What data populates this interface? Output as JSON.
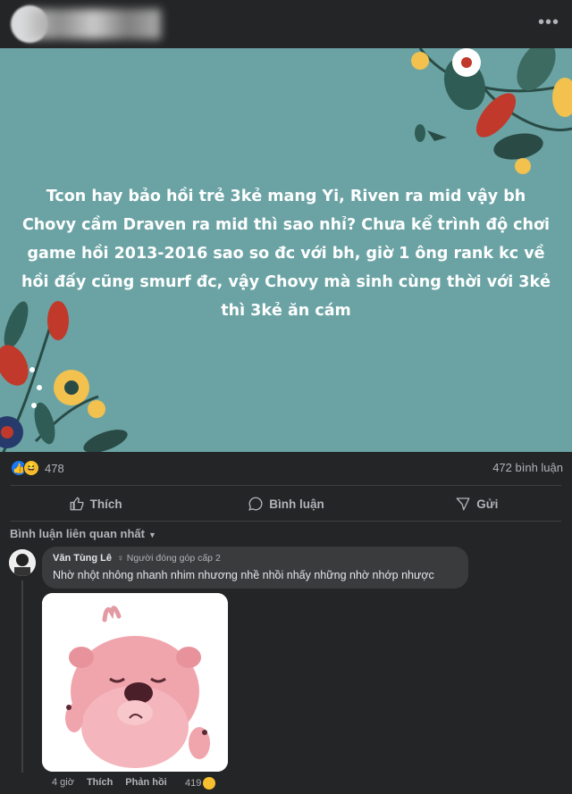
{
  "post": {
    "more_icon": "more-horizontal-icon",
    "text": "Tcon hay bảo hồi trẻ 3kẻ mang Yi, Riven ra mid vậy bh Chovy cầm Draven ra mid thì sao nhỉ? Chưa kể trình độ chơi game hồi 2013-2016 sao so đc với bh, giờ 1 ông rank kc về hồi đấy cũng smurf đc, vậy Chovy mà sinh cùng thời với 3kẻ thì 3kẻ ăn cám",
    "banner_color": "#6ba3a4"
  },
  "stats": {
    "reaction_count": "478",
    "comment_count": "472 bình luận"
  },
  "actions": {
    "like": "Thích",
    "comment": "Bình luận",
    "share": "Gửi"
  },
  "comments": {
    "sort_label": "Bình luận liên quan nhất",
    "items": [
      {
        "author": "Văn Tùng Lê",
        "badge": "Người đóng góp cấp 2",
        "text": "Nhờ nhột nhông nhanh nhim nhương nhề nhồi nhấy những nhờ nhớp nhược",
        "time": "4 giờ",
        "like": "Thích",
        "reply": "Phản hồi",
        "reactions": "419"
      }
    ]
  },
  "colors": {
    "background": "#242526",
    "bubble": "#3a3b3c",
    "accent": "#1877f2"
  }
}
